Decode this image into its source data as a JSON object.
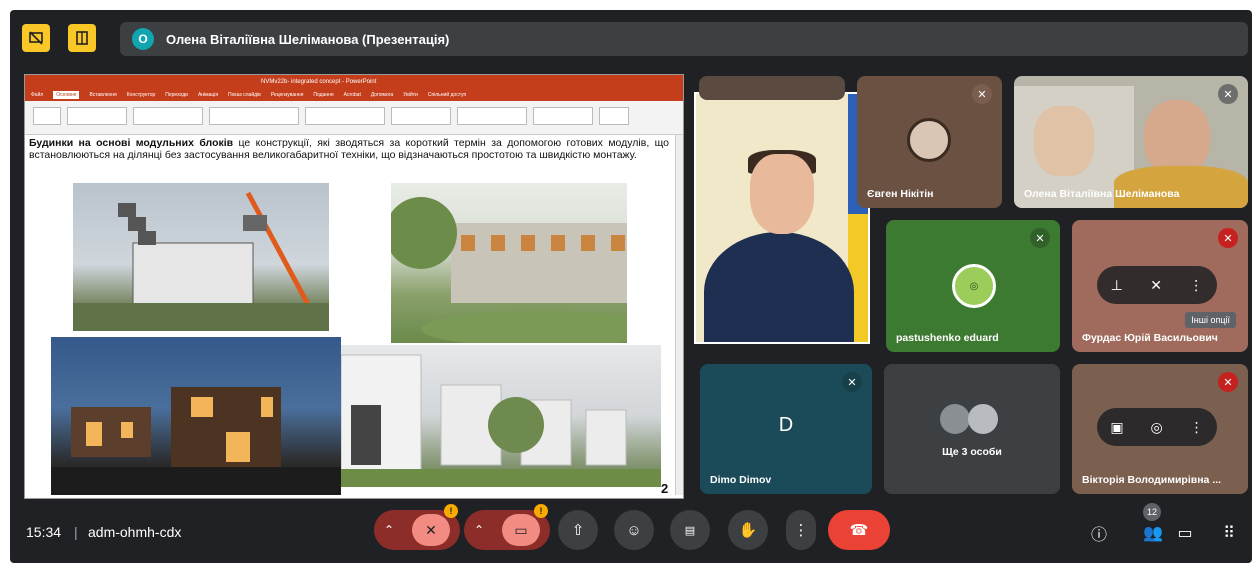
{
  "top_bar": {
    "left_button_1_icon": "presentation-off-icon",
    "left_button_2_icon": "pin-window-icon",
    "presenter_initial": "О",
    "presenter_label": "Олена Віталіївна Шеліманова (Презентація)"
  },
  "slide": {
    "ppt_window_title": "NVMv22b- integrated concept - PowerPoint",
    "ppt_menu": [
      "Файл",
      "Основне",
      "Вставлення",
      "Конструктор",
      "Переходи",
      "Анімація",
      "Показ слайдів",
      "Рецензування",
      "Подання",
      "Acrobat",
      "Допомога",
      "Увійти",
      "Спільний доступ"
    ],
    "text_bold": "Будинки на основі модульних блоків",
    "text_rest": " це конструкції, які зводяться за короткий термін за допомогою готових модулів, що встановлюються на ділянці без застосування великогабаритної техніки, що відзначаються простотою та швидкістю монтажу.",
    "page_number": "2"
  },
  "tiles": [
    {
      "name": "Євген Нікітін"
    },
    {
      "name": "Олена Віталіївна Шеліманова"
    },
    {
      "name": "pastushenko eduard"
    },
    {
      "name": "Фурдас Юрій Васильович"
    },
    {
      "name": "Dimo Dimov",
      "letter": "D"
    },
    {
      "name": "Ще 3 особи"
    },
    {
      "name": "Вікторія Володимирівна ..."
    }
  ],
  "tooltip": "Інші опції",
  "bottom_bar": {
    "time": "15:34",
    "separator": "|",
    "meeting_code": "adm-ohmh-cdx",
    "mic_warning": "!",
    "cam_warning": "!",
    "participants_count": "12"
  },
  "colors": {
    "background": "#202124",
    "accent_yellow": "#f9c726",
    "end_call": "#ea4335",
    "muted_red": "#8c2d2a",
    "presenter_avatar": "#12a4af"
  }
}
